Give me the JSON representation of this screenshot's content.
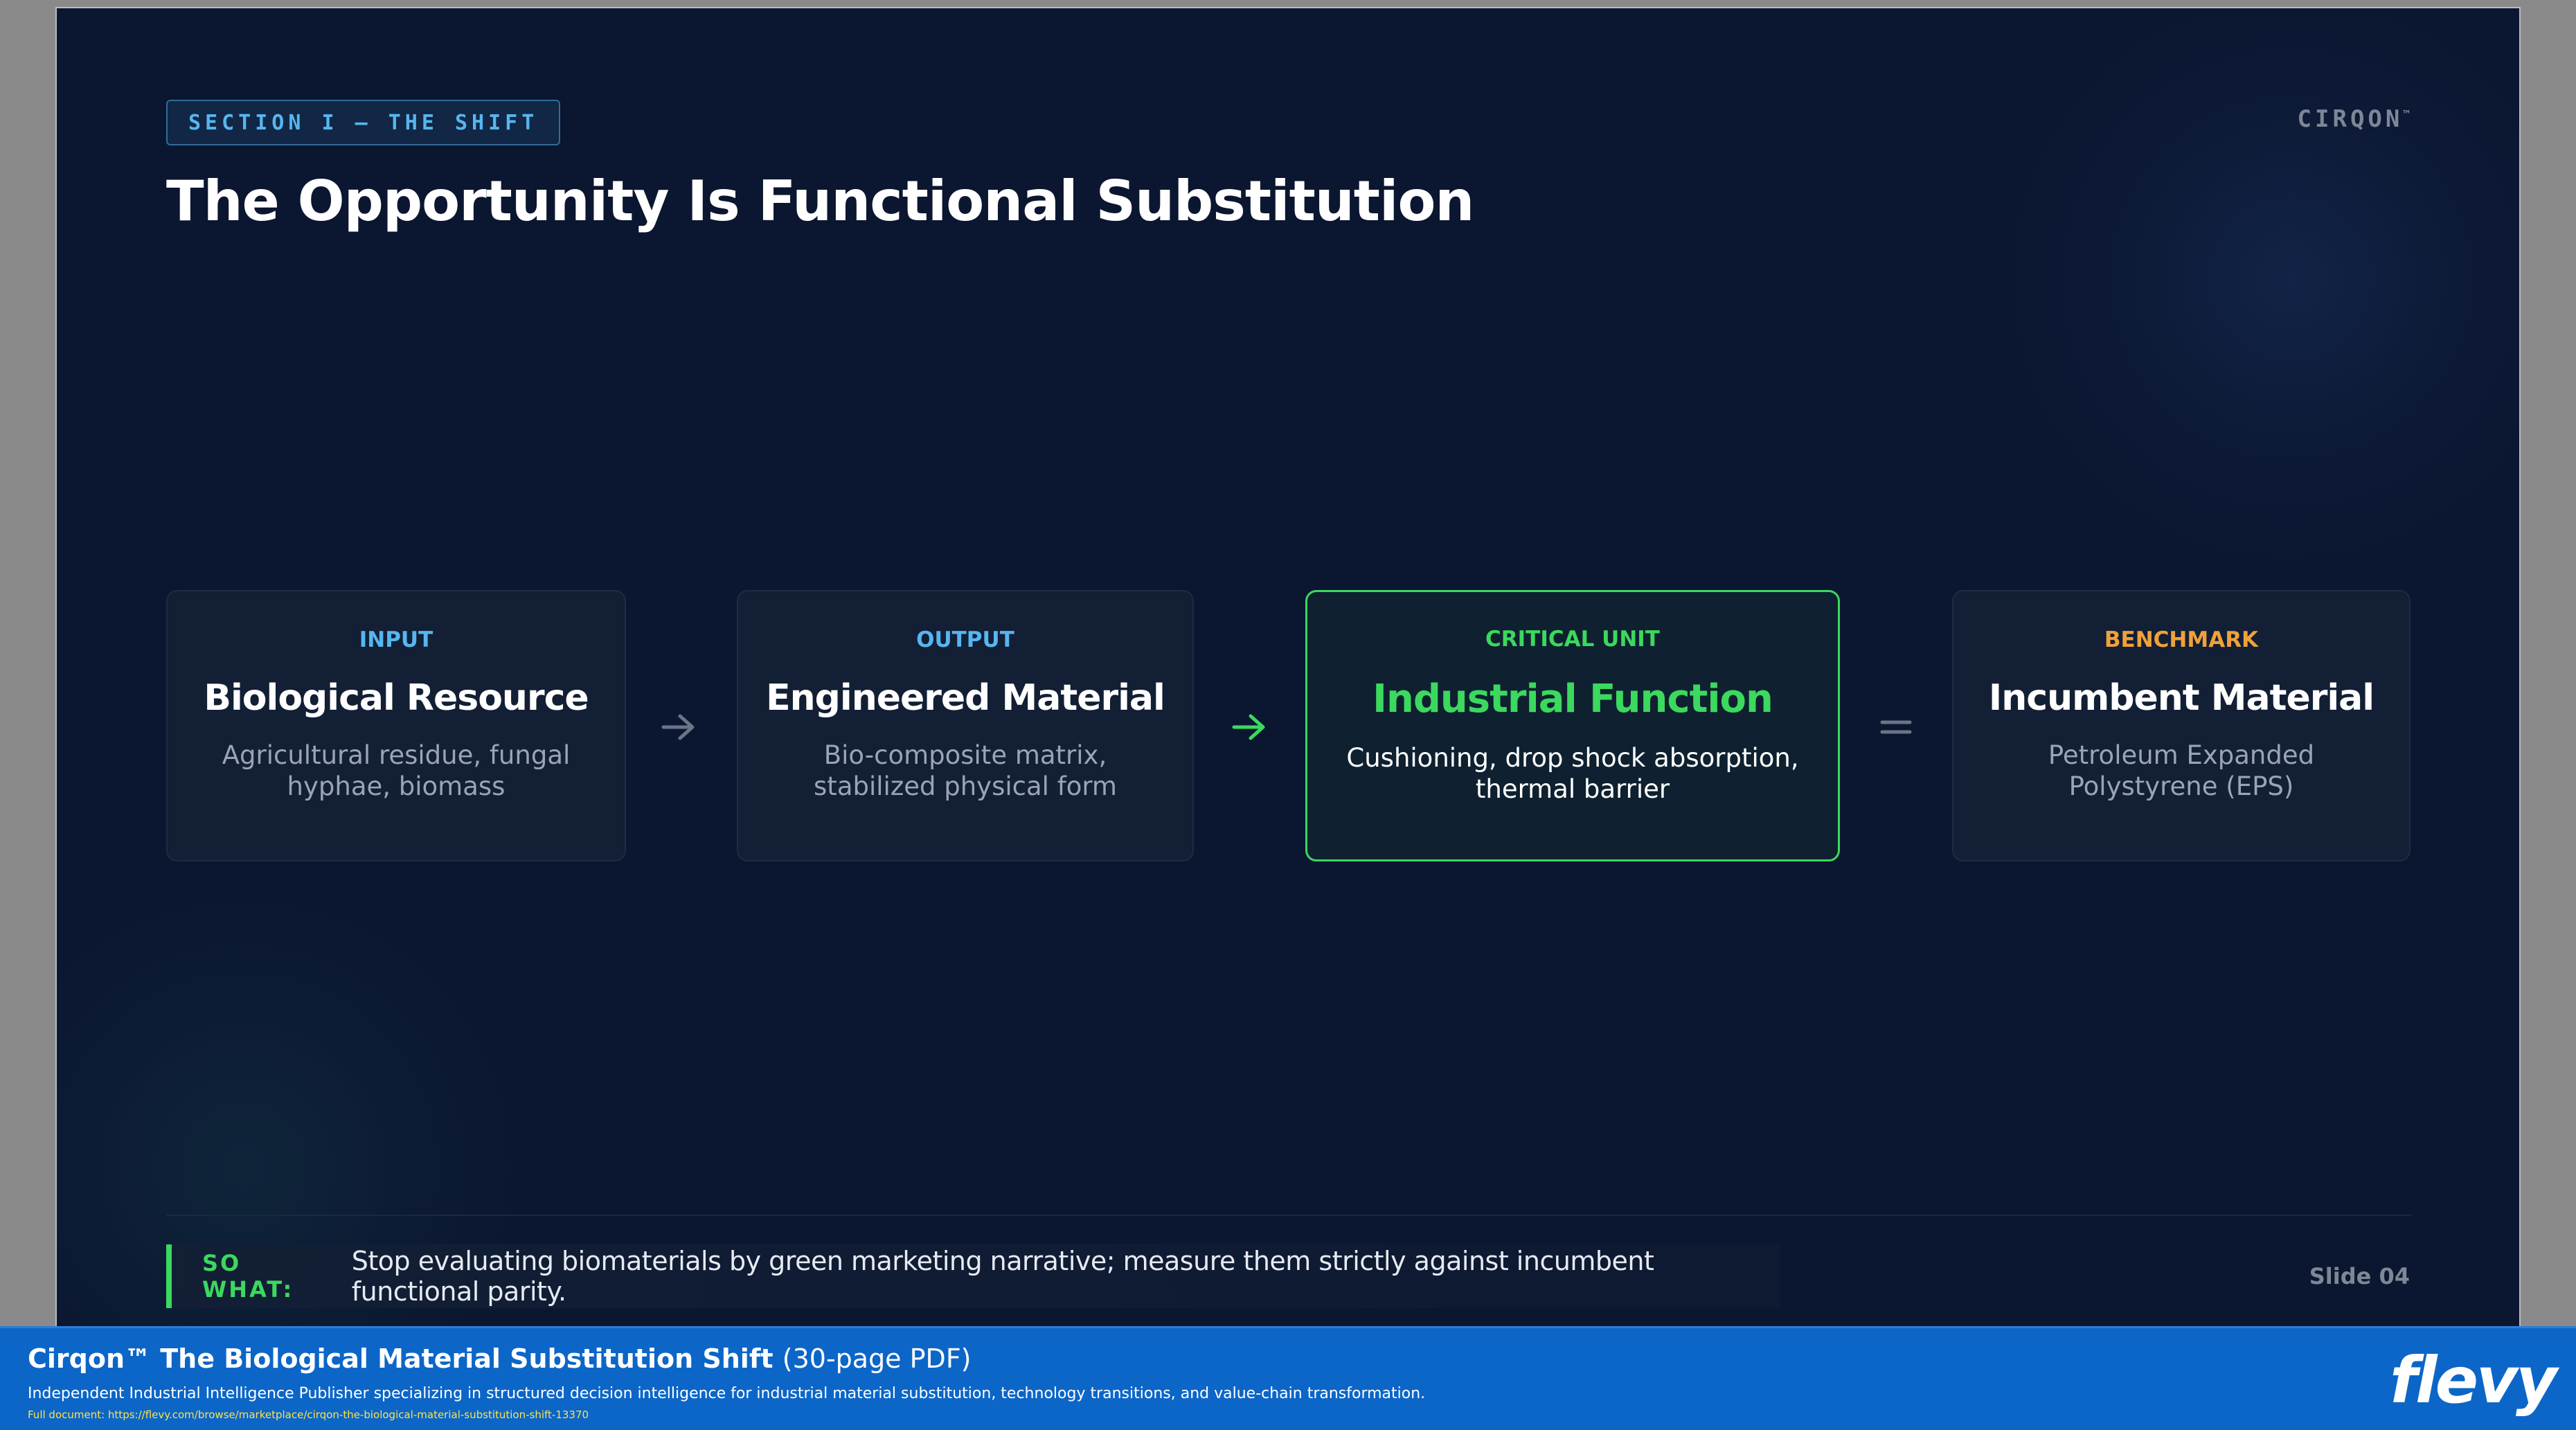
{
  "slide": {
    "section_tag": "SECTION I — THE SHIFT",
    "brand": {
      "name": "CIRQON",
      "mark": "™"
    },
    "title": "The Opportunity Is Functional Substitution",
    "cards": [
      {
        "eyebrow": "INPUT",
        "heading": "Biological Resource",
        "desc_lines": [
          "Agricultural residue, fungal",
          "hyphae, biomass"
        ]
      },
      {
        "eyebrow": "OUTPUT",
        "heading": "Engineered Material",
        "desc_lines": [
          "Bio-composite matrix,",
          "stabilized physical form"
        ]
      },
      {
        "eyebrow": "CRITICAL UNIT",
        "heading": "Industrial Function",
        "desc_lines": [
          "Cushioning, drop shock absorption,",
          "thermal barrier"
        ]
      },
      {
        "eyebrow": "BENCHMARK",
        "heading": "Incumbent Material",
        "desc_lines": [
          "Petroleum Expanded",
          "Polystyrene (EPS)"
        ]
      }
    ],
    "connectors": [
      {
        "icon": "arrow-right-icon",
        "color": "#6b7587"
      },
      {
        "icon": "arrow-right-icon",
        "color": "#3bd95e"
      },
      {
        "icon": "equals-icon",
        "color": "#6b7587"
      }
    ],
    "so_what": {
      "label": "SO WHAT:",
      "text": "Stop evaluating biomaterials by green marketing narrative; measure them strictly against incumbent functional parity."
    },
    "slide_number": "Slide 04",
    "colors": {
      "background": "#0b1630",
      "accent_green": "#3bd95e",
      "accent_blue": "#56b6f0",
      "accent_orange": "#f0a13a"
    }
  },
  "footer": {
    "title": "Cirqon™ The Biological Material Substitution Shift",
    "pages": "(30-page PDF)",
    "subtitle": "Independent Industrial Intelligence Publisher specializing in structured decision intelligence for industrial material substitution, technology transitions, and value-chain transformation.",
    "link": "Full document: https://flevy.com/browse/marketplace/cirqon-the-biological-material-substitution-shift-13370",
    "logo": "flevy"
  }
}
